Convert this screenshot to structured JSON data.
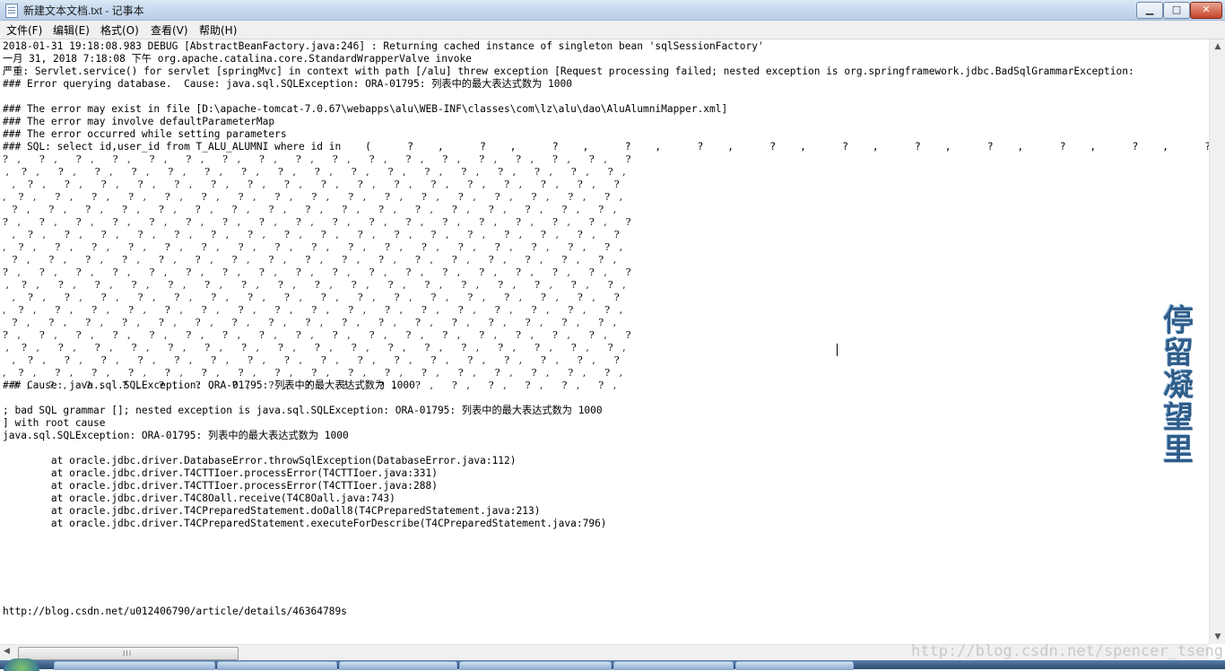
{
  "window": {
    "title": "新建文本文档.txt - 记事本",
    "minimize": "▁",
    "maximize": "□",
    "close": "✕"
  },
  "menu": [
    "文件(F)",
    "编辑(E)",
    "格式(O)",
    "查看(V)",
    "帮助(H)"
  ],
  "content": {
    "lines": [
      "2018-01-31 19:18:08.983 DEBUG [AbstractBeanFactory.java:246] : Returning cached instance of singleton bean 'sqlSessionFactory'",
      "一月 31, 2018 7:18:08 下午 org.apache.catalina.core.StandardWrapperValve invoke",
      "严重: Servlet.service() for servlet [springMvc] in context with path [/alu] threw exception [Request processing failed; nested exception is org.springframework.jdbc.BadSqlGrammarException:",
      "### Error querying database.  Cause: java.sql.SQLException: ORA-01795: 列表中的最大表达式数为 1000",
      "",
      "### The error may exist in file [D:\\apache-tomcat-7.0.67\\webapps\\alu\\WEB-INF\\classes\\com\\lz\\alu\\dao\\AluAlumniMapper.xml]",
      "### The error may involve defaultParameterMap",
      "### The error occurred while setting parameters",
      "### SQL: select id,user_id from T_ALU_ALUMNI where id in    (      ?    ,      ?    ,      ?    ,      ?    ,      ?    ,      ?    ,      ?    ,      ?    ,      ?    ,      ?    ,      ?    ,      ?"
    ],
    "question_rows": [
      "?   ,      ?   ,      ?   ,      ?   ,      ?   ,      ?   ,      ?   ,      ?   ,      ?   ,      ?   ,      ?   ,      ?   ,      ?   ,      ?   ,      ?   ,      ?   ,      ?   ,      ?",
      " ,    ?   ,      ?   ,      ?   ,      ?   ,      ?   ,      ?   ,      ?   ,      ?   ,      ?   ,      ?   ,      ?   ,      ?   ,      ?   ,      ?   ,      ?   ,      ?   ,      ?   ,",
      "   ,    ?   ,      ?   ,      ?   ,      ?   ,      ?   ,      ?   ,      ?   ,      ?   ,      ?   ,      ?   ,      ?   ,      ?   ,      ?   ,      ?   ,      ?   ,      ?   ,      ?",
      ",    ?   ,      ?   ,      ?   ,      ?   ,      ?   ,      ?   ,      ?   ,      ?   ,      ?   ,      ?   ,      ?   ,      ?   ,      ?   ,      ?   ,      ?   ,      ?   ,      ?   ,",
      "   ?   ,      ?   ,      ?   ,      ?   ,      ?   ,      ?   ,      ?   ,      ?   ,      ?   ,      ?   ,      ?   ,      ?   ,      ?   ,      ?   ,      ?   ,      ?   ,      ?   ,",
      "?   ,      ?   ,      ?   ,      ?   ,      ?   ,      ?   ,      ?   ,      ?   ,      ?   ,      ?   ,      ?   ,      ?   ,      ?   ,      ?   ,      ?   ,      ?   ,      ?   ,      ?",
      "   ,    ?   ,      ?   ,      ?   ,      ?   ,      ?   ,      ?   ,      ?   ,      ?   ,      ?   ,      ?   ,      ?   ,      ?   ,      ?   ,      ?   ,      ?   ,      ?   ,      ?",
      ",    ?   ,      ?   ,      ?   ,      ?   ,      ?   ,      ?   ,      ?   ,      ?   ,      ?   ,      ?   ,      ?   ,      ?   ,      ?   ,      ?   ,      ?   ,      ?   ,      ?   ,",
      "   ?   ,      ?   ,      ?   ,      ?   ,      ?   ,      ?   ,      ?   ,      ?   ,      ?   ,      ?   ,      ?   ,      ?   ,      ?   ,      ?   ,      ?   ,      ?   ,      ?   ,",
      "?   ,      ?   ,      ?   ,      ?   ,      ?   ,      ?   ,      ?   ,      ?   ,      ?   ,      ?   ,      ?   ,      ?   ,      ?   ,      ?   ,      ?   ,      ?   ,      ?   ,      ?",
      " ,    ?   ,      ?   ,      ?   ,      ?   ,      ?   ,      ?   ,      ?   ,      ?   ,      ?   ,      ?   ,      ?   ,      ?   ,      ?   ,      ?   ,      ?   ,      ?   ,      ?   ,",
      "   ,    ?   ,      ?   ,      ?   ,      ?   ,      ?   ,      ?   ,      ?   ,      ?   ,      ?   ,      ?   ,      ?   ,      ?   ,      ?   ,      ?   ,      ?   ,      ?   ,      ?",
      ",    ?   ,      ?   ,      ?   ,      ?   ,      ?   ,      ?   ,      ?   ,      ?   ,      ?   ,      ?   ,      ?   ,      ?   ,      ?   ,      ?   ,      ?   ,      ?   ,      ?   ,",
      "   ?   ,      ?   ,      ?   ,      ?   ,      ?   ,      ?   ,      ?   ,      ?   ,      ?   ,      ?   ,      ?   ,      ?   ,      ?   ,      ?   ,      ?   ,      ?   ,      ?   ,",
      "?   ,      ?   ,      ?   ,      ?   ,      ?   ,      ?   ,      ?   ,      ?   ,      ?   ,      ?   ,      ?   ,      ?   ,      ?   ,      ?   ,      ?   ,      ?   ,      ?   ,      ?",
      " ,    ?   ,      ?   ,      ?   ,      ?   ,      ?   ,      ?   ,      ?   ,      ?   ,      ?   ,      ?   ,      ?   ,      ?   ,      ?   ,      ?   ,      ?   ,      ?   ,      ?   ,",
      "   ,    ?   ,      ?   ,      ?   ,      ?   ,      ?   ,      ?   ,      ?   ,      ?   ,      ?   ,      ?   ,      ?   ,      ?   ,      ?   ,      ?   ,      ?   ,      ?   ,      ?",
      ",    ?   ,      ?   ,      ?   ,      ?   ,      ?   ,      ?   ,      ?   ,      ?   ,      ?   ,      ?   ,      ?   ,      ?   ,      ?   ,      ?   ,      ?   ,      ?   ,      ?   ,",
      "   ?   ,      ?   ,      ?   ,      ?   ,      ?   ,      ?   ,      ?   ,      ?   ,      ?   ,      ?   ,      ?   ,      ?   ,      ?   ,      ?   ,      ?   ,      ?   ,      ?   ,"
    ],
    "after_lines": [
      "### Cause: java.sql.SQLException: ORA-01795: 列表中的最大表达式数为 1000",
      "",
      "; bad SQL grammar []; nested exception is java.sql.SQLException: ORA-01795: 列表中的最大表达式数为 1000",
      "] with root cause",
      "java.sql.SQLException: ORA-01795: 列表中的最大表达式数为 1000",
      "",
      "        at oracle.jdbc.driver.DatabaseError.throwSqlException(DatabaseError.java:112)",
      "        at oracle.jdbc.driver.T4CTTIoer.processError(T4CTTIoer.java:331)",
      "        at oracle.jdbc.driver.T4CTTIoer.processError(T4CTTIoer.java:288)",
      "        at oracle.jdbc.driver.T4C8Oall.receive(T4C8Oall.java:743)",
      "        at oracle.jdbc.driver.T4CPreparedStatement.doOall8(T4CPreparedStatement.java:213)",
      "        at oracle.jdbc.driver.T4CPreparedStatement.executeForDescribe(T4CPreparedStatement.java:796)"
    ],
    "url_line": "http://blog.csdn.net/u012406790/article/details/46364789s"
  },
  "watermarks": {
    "side": "停留凝望里",
    "bottom": "http://blog.csdn.net/spencer_tseng"
  },
  "scrollbar": {
    "up": "▲",
    "down": "▼",
    "left": "◀",
    "grip": "III"
  }
}
